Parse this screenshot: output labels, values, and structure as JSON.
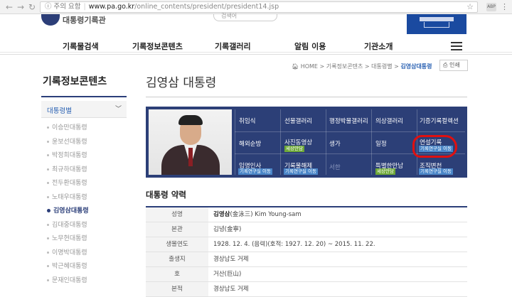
{
  "browser": {
    "security_label": "주의 요함",
    "url_host": "www.pa.go.kr",
    "url_path": "/online_contents/president/president14.jsp",
    "extension_label": "ABP"
  },
  "header": {
    "logo_text": "대통령기록관",
    "search_placeholder": "검색어"
  },
  "gnb": {
    "items": [
      "기록물검색",
      "기록정보콘텐츠",
      "기록갤러리",
      "알림 이용",
      "기관소개"
    ]
  },
  "sidebar": {
    "title": "기록정보콘텐츠",
    "category": "대통령별",
    "items": [
      "이승만대통령",
      "윤보선대통령",
      "박정희대통령",
      "최규하대통령",
      "전두환대통령",
      "노태우대통령",
      "김영삼대통령",
      "김대중대통령",
      "노무현대통령",
      "이명박대통령",
      "박근혜대통령",
      "문재인대통령"
    ],
    "active_index": 6
  },
  "page": {
    "title": "김영삼 대통령",
    "breadcrumb": [
      "HOME",
      "기록정보콘텐츠",
      "대통령별",
      "김영삼대통령"
    ],
    "print_label": "인쇄"
  },
  "menu_grid": {
    "cells": [
      {
        "label": "취임식"
      },
      {
        "label": "선물갤러리"
      },
      {
        "label": "행정박물갤러리"
      },
      {
        "label": "의상갤러리"
      },
      {
        "label": "기증기록컬렉션"
      },
      {
        "label": "해외순방"
      },
      {
        "label": "사진동영상",
        "tag": "세상만담"
      },
      {
        "label": "생가"
      },
      {
        "label": "일정"
      },
      {
        "label": "연설기록",
        "tag": "기록연구실 이동"
      },
      {
        "label": "임명인사",
        "tag": "기록연구실 이동"
      },
      {
        "label": "기록물해제",
        "tag": "기록연구실 이동"
      },
      {
        "label": "서한"
      },
      {
        "label": "특별한만남",
        "tag": "세상만담"
      },
      {
        "label": "조직변천",
        "tag": "기록연구실 이동"
      }
    ],
    "colors": {
      "bg": "#2c3f77",
      "tag_blue": "#4a86c8",
      "tag_green": "#6ea838",
      "highlight": "#e01010"
    }
  },
  "profile": {
    "title": "대통령 약력",
    "rows": [
      {
        "label": "성명",
        "value_bold": "김영삼",
        "value": "(金泳三) Kim Young-sam"
      },
      {
        "label": "본관",
        "value_bold": "",
        "value": "김녕(金寧)"
      },
      {
        "label": "생몰연도",
        "value_bold": "",
        "value": "1928. 12. 4. (음력)(호적: 1927. 12. 20) ~ 2015. 11. 22."
      },
      {
        "label": "출생지",
        "value_bold": "",
        "value": "경상남도 거제"
      },
      {
        "label": "호",
        "value_bold": "",
        "value": "거산(巨山)"
      },
      {
        "label": "본적",
        "value_bold": "",
        "value": "경상남도 거제"
      }
    ]
  }
}
